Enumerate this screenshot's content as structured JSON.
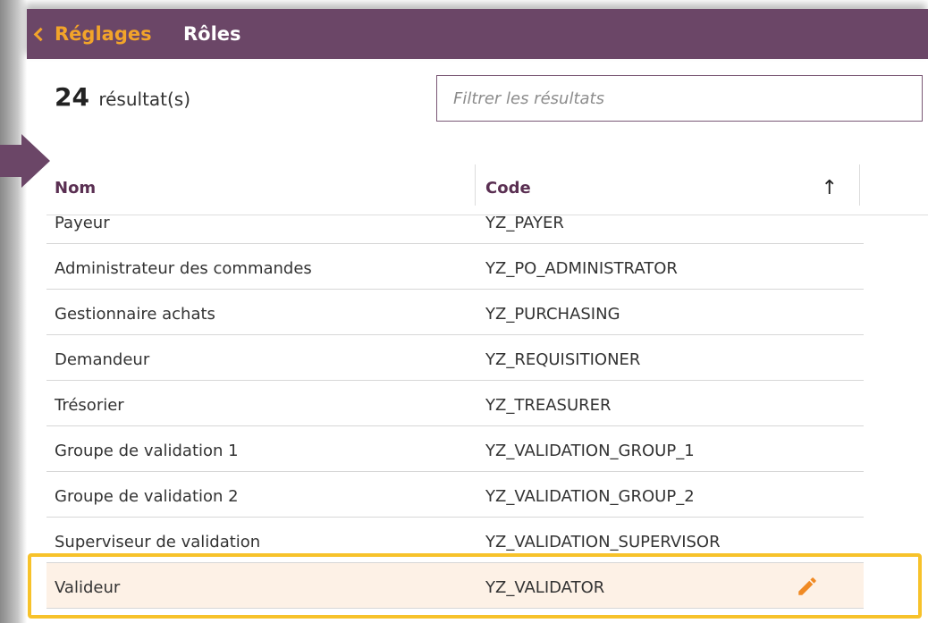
{
  "header": {
    "back_label": "Réglages",
    "title": "Rôles",
    "background": "#6b4667",
    "back_color": "#f2a42a"
  },
  "results": {
    "count": "24",
    "suffix": "résultat(s)"
  },
  "filter": {
    "placeholder": "Filtrer les résultats"
  },
  "table": {
    "columns": {
      "nom": "Nom",
      "code": "Code"
    },
    "sort_icon": "arrow-up-icon",
    "rows": [
      {
        "nom": "Payeur",
        "code": "YZ_PAYER"
      },
      {
        "nom": "Administrateur des commandes",
        "code": "YZ_PO_ADMINISTRATOR"
      },
      {
        "nom": "Gestionnaire achats",
        "code": "YZ_PURCHASING"
      },
      {
        "nom": "Demandeur",
        "code": "YZ_REQUISITIONER"
      },
      {
        "nom": "Trésorier",
        "code": "YZ_TREASURER"
      },
      {
        "nom": "Groupe de validation 1",
        "code": "YZ_VALIDATION_GROUP_1"
      },
      {
        "nom": "Groupe de validation 2",
        "code": "YZ_VALIDATION_GROUP_2"
      },
      {
        "nom": "Superviseur de validation",
        "code": "YZ_VALIDATION_SUPERVISOR"
      },
      {
        "nom": "Valideur",
        "code": "YZ_VALIDATOR"
      }
    ],
    "highlight_color": "#f7c22a",
    "edit_icon_color": "#f08a24"
  }
}
